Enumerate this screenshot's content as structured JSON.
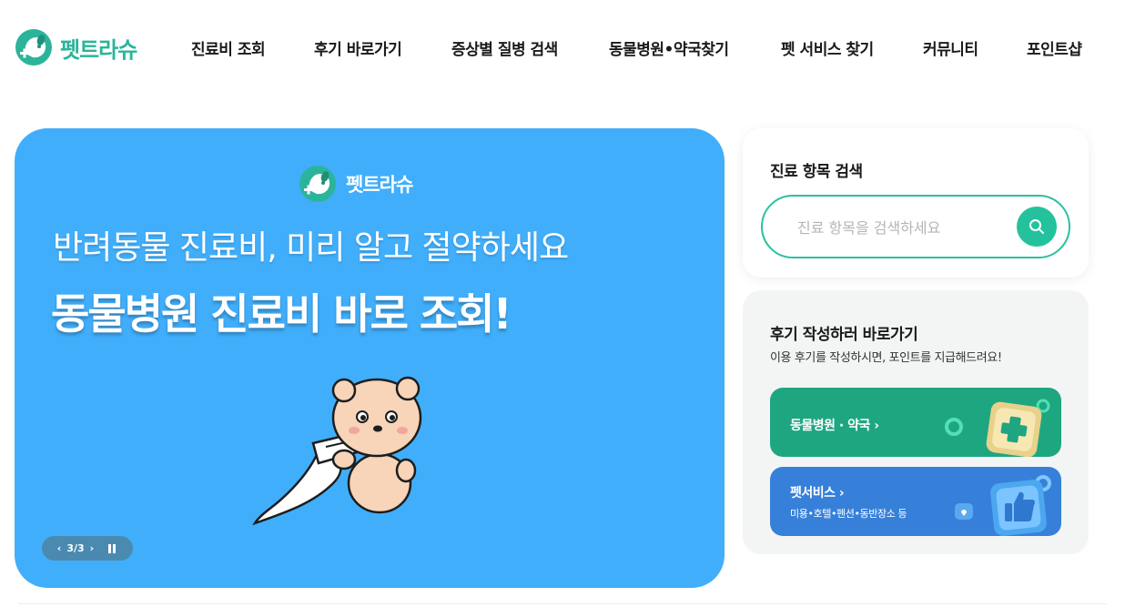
{
  "brand": {
    "name": "펫트라슈",
    "color": "#2bb49a"
  },
  "nav": {
    "items": [
      {
        "label": "진료비 조회"
      },
      {
        "label": "후기 바로가기"
      },
      {
        "label": "증상별 질병 검색"
      },
      {
        "label": "동물병원•약국찾기"
      },
      {
        "label": "펫 서비스 찾기"
      },
      {
        "label": "커뮤니티"
      },
      {
        "label": "포인트샵"
      }
    ]
  },
  "banner": {
    "brand": "펫트라슈",
    "line1": "반려동물 진료비, 미리 알고 절약하세요",
    "line2": "동물병원 진료비 바로 조회!",
    "background": "#41aefb",
    "pager": {
      "prev": "‹",
      "count": "3/3",
      "next": "›",
      "pause_icon": "pause-icon"
    }
  },
  "search": {
    "title": "진료 항목 검색",
    "placeholder": "진료 항목을 검색하세요",
    "value": "",
    "accent": "#23c29c"
  },
  "review": {
    "title": "후기 작성하러 바로가기",
    "desc": "이용 후기를 작성하시면, 포인트를 지급해드려요!",
    "cards": [
      {
        "label": "동물병원 · 약국 ›",
        "sub": "",
        "color": "#1ea681",
        "icon": "medical-cross-icon"
      },
      {
        "label": "펫서비스 ›",
        "sub": "미용•호텔•펜션•동반장소 등",
        "color": "#3780d9",
        "icon": "thumbs-up-icon"
      }
    ]
  }
}
